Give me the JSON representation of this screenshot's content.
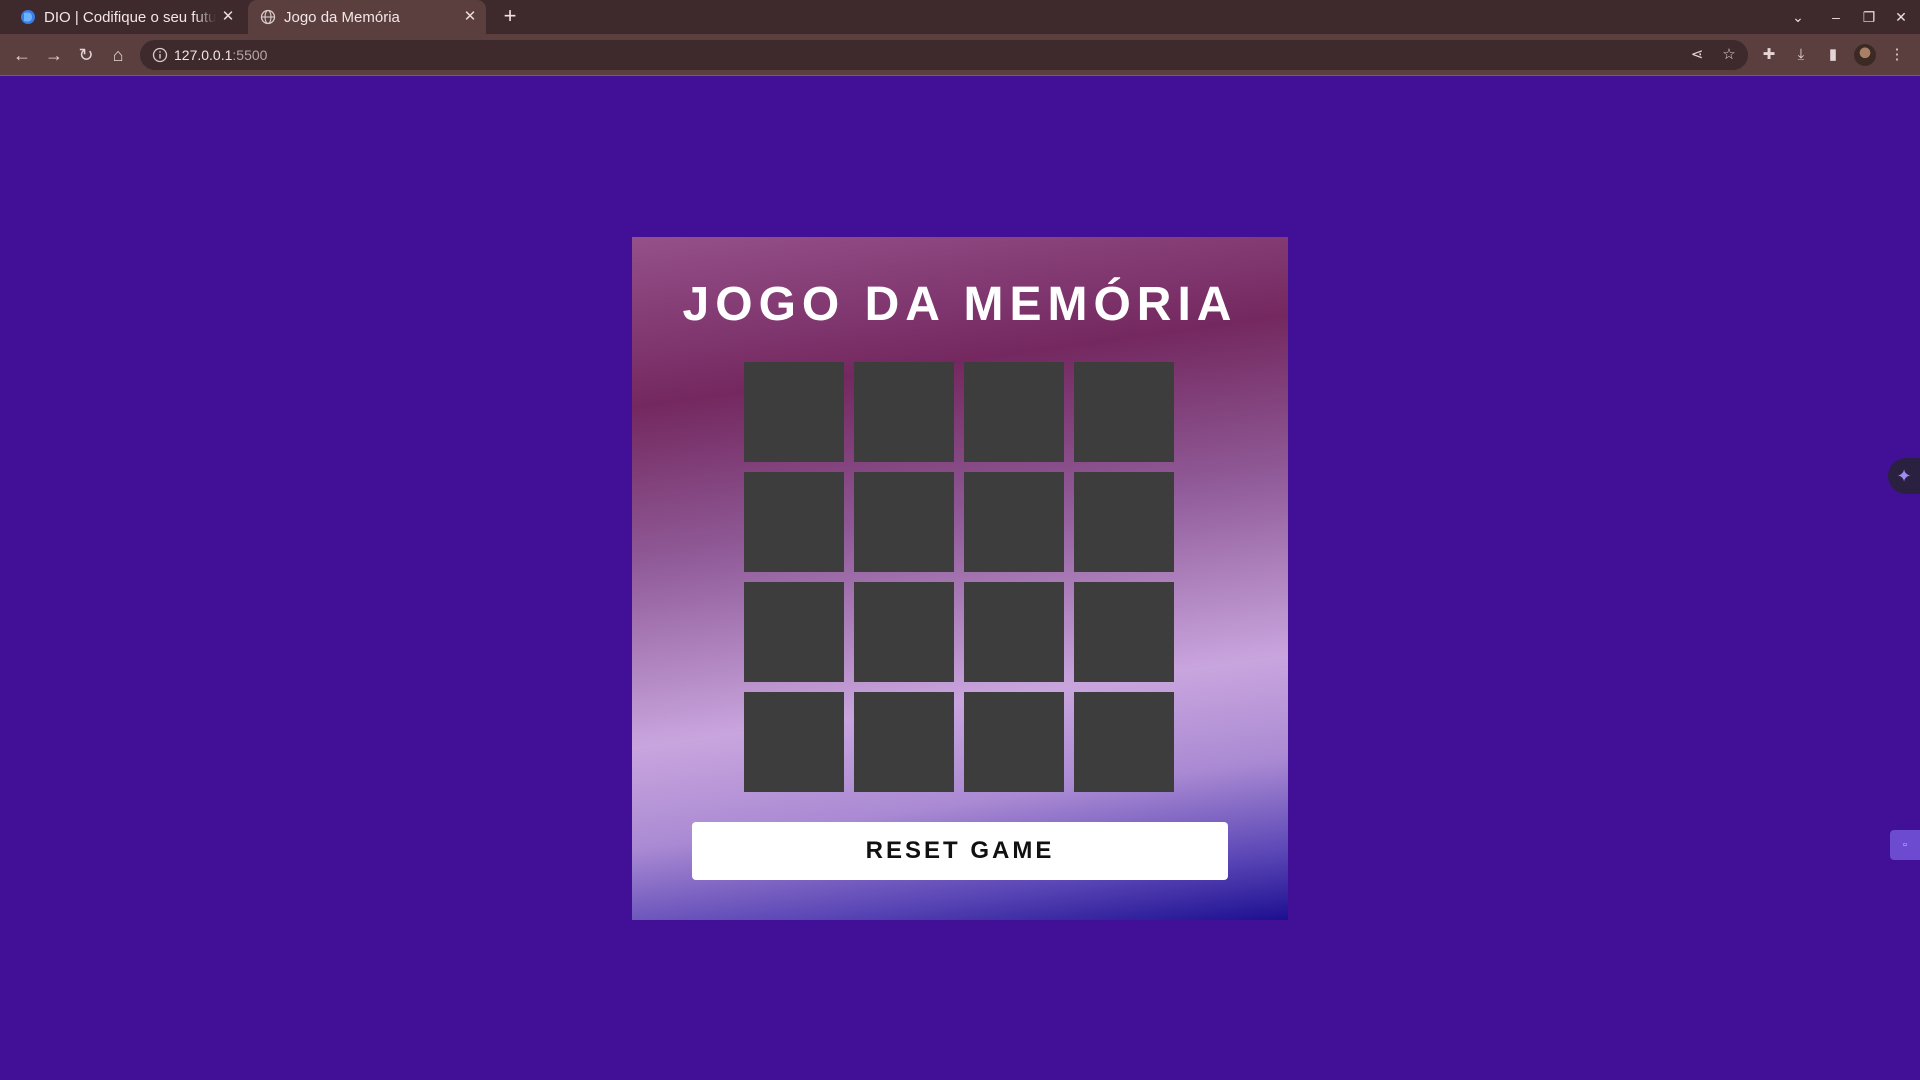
{
  "browser": {
    "tabs": [
      {
        "title": "DIO | Codifique o seu futuro global agora",
        "icon": "dio-favicon-icon",
        "active": false
      },
      {
        "title": "Jogo da Memória",
        "icon": "globe-icon",
        "active": true
      }
    ],
    "new_tab_icon": "plus-icon",
    "close_icon": "close-icon",
    "address": {
      "host": "127.0.0.1",
      "port": ":5500"
    },
    "colors": {
      "titlebar": "#3e2a2c",
      "toolbar": "#5b3f3f"
    }
  },
  "page": {
    "background": "#421097",
    "title": "JOGO DA MEMÓRIA",
    "cards": [
      {
        "state": "hidden"
      },
      {
        "state": "hidden"
      },
      {
        "state": "hidden"
      },
      {
        "state": "hidden"
      },
      {
        "state": "hidden"
      },
      {
        "state": "hidden"
      },
      {
        "state": "hidden"
      },
      {
        "state": "hidden"
      },
      {
        "state": "hidden"
      },
      {
        "state": "hidden"
      },
      {
        "state": "hidden"
      },
      {
        "state": "hidden"
      },
      {
        "state": "hidden"
      },
      {
        "state": "hidden"
      },
      {
        "state": "hidden"
      },
      {
        "state": "hidden"
      }
    ],
    "card_color": "#3d3d3d",
    "reset_label": "RESET GAME"
  }
}
